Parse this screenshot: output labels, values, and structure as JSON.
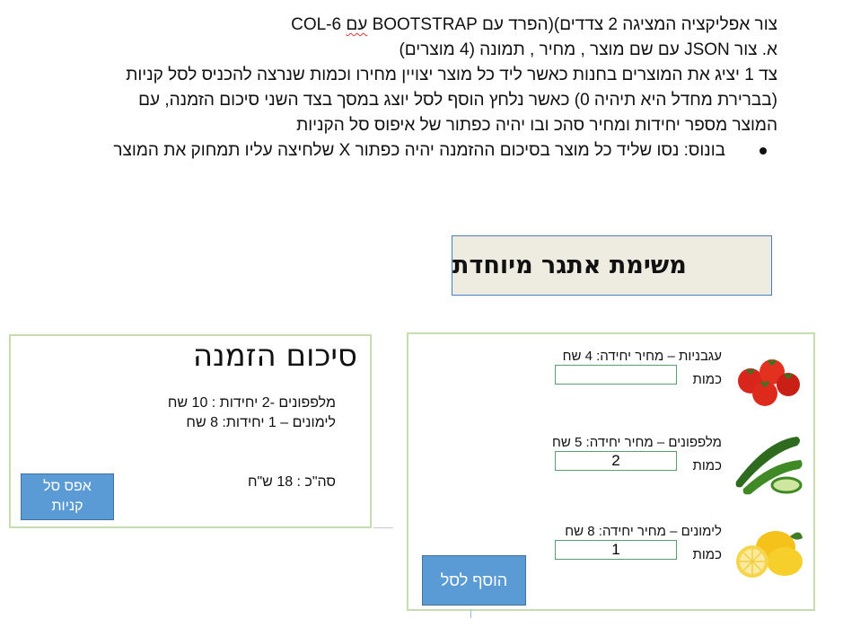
{
  "instructions": {
    "line1_prefix": "צור אפליקציה המציגה 2 צדדים)(הפרד עם BOOTSTRAP ",
    "line1_squig": "עם",
    "line1_suffix": " COL-6",
    "line2": "א. צור JSON עם שם מוצר , מחיר , תמונה (4 מוצרים)",
    "line3": "צד 1 יציג את המוצרים בחנות כאשר ליד כל מוצר יצויין מחירו וכמות שנרצה להכניס לסל קניות",
    "line4": "(בברירת מחדל היא תיהיה 0) כאשר נלחץ הוסף לסל יוצג במסך בצד השני סיכום הזמנה, עם",
    "line5": "המוצר מספר יחידות ומחיר סהכ ובו יהיה כפתור של איפוס סל הקניות",
    "bonus": "בונוס: נסו שליד כל מוצר בסיכום ההזמנה יהיה כפתור X שלחיצה עליו תמחוק את המוצר"
  },
  "challenge": {
    "title": "משימת אתגר מיוחדת"
  },
  "summary": {
    "title": "סיכום הזמנה",
    "lines": [
      "מלפפונים -2 יחידות : 10 שח",
      "לימונים – 1 יחידות: 8 שח"
    ],
    "total": "סה\"כ : 18 ש\"ח",
    "reset_line1": "אפס סל",
    "reset_line2": "קניות"
  },
  "products": [
    {
      "name": "עגבניות – מחיר יחידה: 4 שח",
      "qty_label": "כמות",
      "qty": "",
      "icon": "tomato-icon"
    },
    {
      "name": "מלפפונים – מחיר יחידה: 5 שח",
      "qty_label": "כמות",
      "qty": "2",
      "icon": "cucumber-icon"
    },
    {
      "name": "לימונים – מחיר יחידה: 8 שח",
      "qty_label": "כמות",
      "qty": "1",
      "icon": "lemon-icon"
    }
  ],
  "add_button": "הוסף לסל",
  "colors": {
    "button": "#5b9bd5",
    "panel_border": "#c5ddb0",
    "challenge_bg": "#eeece1",
    "input_border": "#5a9f6a"
  }
}
